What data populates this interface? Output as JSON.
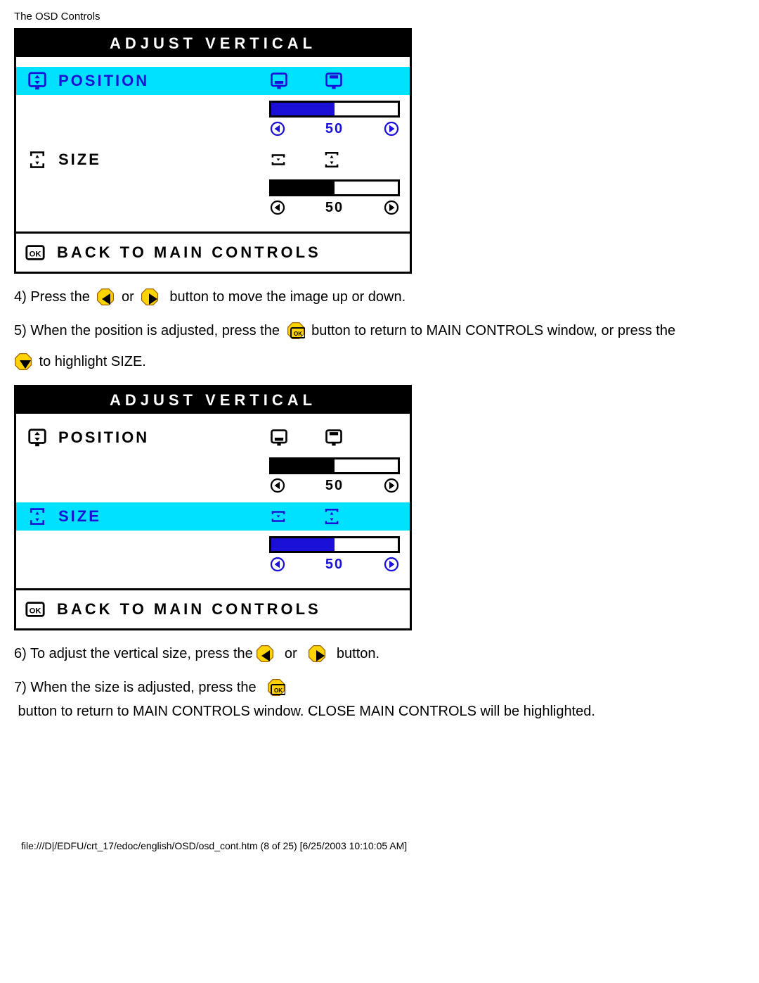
{
  "header": "The OSD Controls",
  "osd1": {
    "title": "ADJUST VERTICAL",
    "position_label": "POSITION",
    "size_label": "SIZE",
    "position_value": "50",
    "size_value": "50",
    "back_label": "BACK TO MAIN CONTROLS",
    "position_highlighted": true,
    "position_fill": 50,
    "size_fill": 50
  },
  "osd2": {
    "title": "ADJUST VERTICAL",
    "position_label": "POSITION",
    "size_label": "SIZE",
    "position_value": "50",
    "size_value": "50",
    "back_label": "BACK TO MAIN CONTROLS",
    "size_highlighted": true,
    "position_fill": 50,
    "size_fill": 50
  },
  "step4": {
    "a": "4) Press the ",
    "b": " or ",
    "c": "  button to move the image up or down."
  },
  "step5": {
    "a": "5) When the position is adjusted, press the ",
    "b": " button to return to MAIN CONTROLS window, or press the",
    "c": " to highlight SIZE."
  },
  "step6": {
    "a": "6) To adjust the vertical size, press the",
    "b": "  or  ",
    "c": "  button."
  },
  "step7": {
    "a": "7) When the size is adjusted, press the  ",
    "b": " button to return to MAIN CONTROLS window. CLOSE MAIN CONTROLS will be highlighted."
  },
  "footer": "file:///D|/EDFU/crt_17/edoc/english/OSD/osd_cont.htm (8 of 25) [6/25/2003 10:10:05 AM]"
}
